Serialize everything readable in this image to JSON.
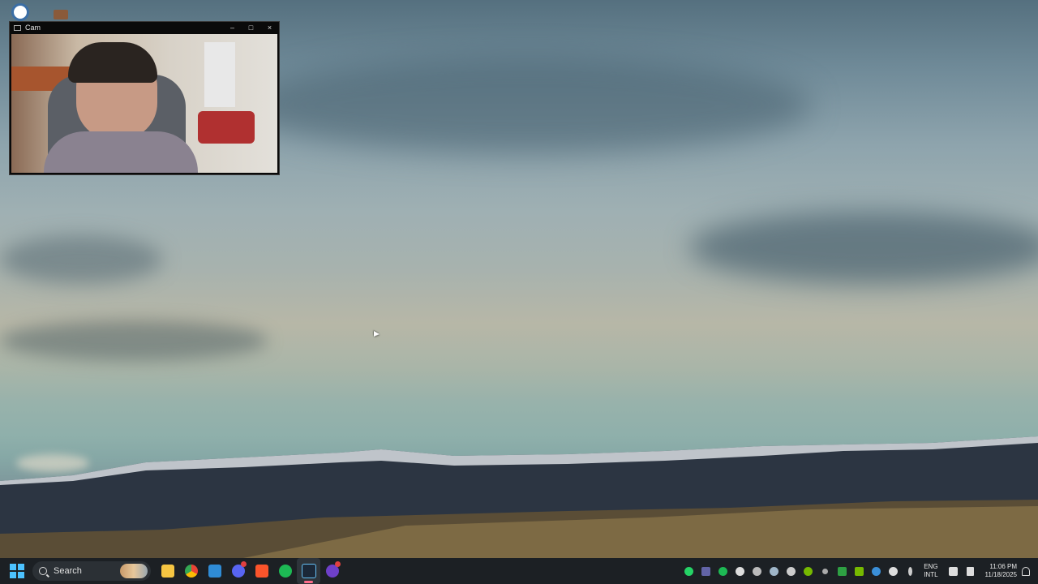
{
  "cam_window": {
    "title": "Cam",
    "minimize": "–",
    "maximize": "□",
    "close": "×"
  },
  "taskbar": {
    "search_label": "Search",
    "apps": [
      {
        "name": "file-explorer",
        "color": "#f5c542"
      },
      {
        "name": "chrome",
        "color": "#34a853"
      },
      {
        "name": "vscode",
        "color": "#2f8cd6"
      },
      {
        "name": "discord",
        "color": "#5865f2",
        "badge": true
      },
      {
        "name": "brave",
        "color": "#fb542b"
      },
      {
        "name": "spotify",
        "color": "#1db954"
      },
      {
        "name": "steam",
        "color": "#1b2838",
        "active": true
      },
      {
        "name": "github-desktop",
        "color": "#6e40c9",
        "badge": true
      }
    ],
    "tray": {
      "language": "ENG",
      "layout": "INTL",
      "time": "11:06 PM",
      "date": "11/18/2025"
    }
  },
  "colors": {
    "taskbar_bg": "#1c2024",
    "accent": "#4cc2ff"
  }
}
